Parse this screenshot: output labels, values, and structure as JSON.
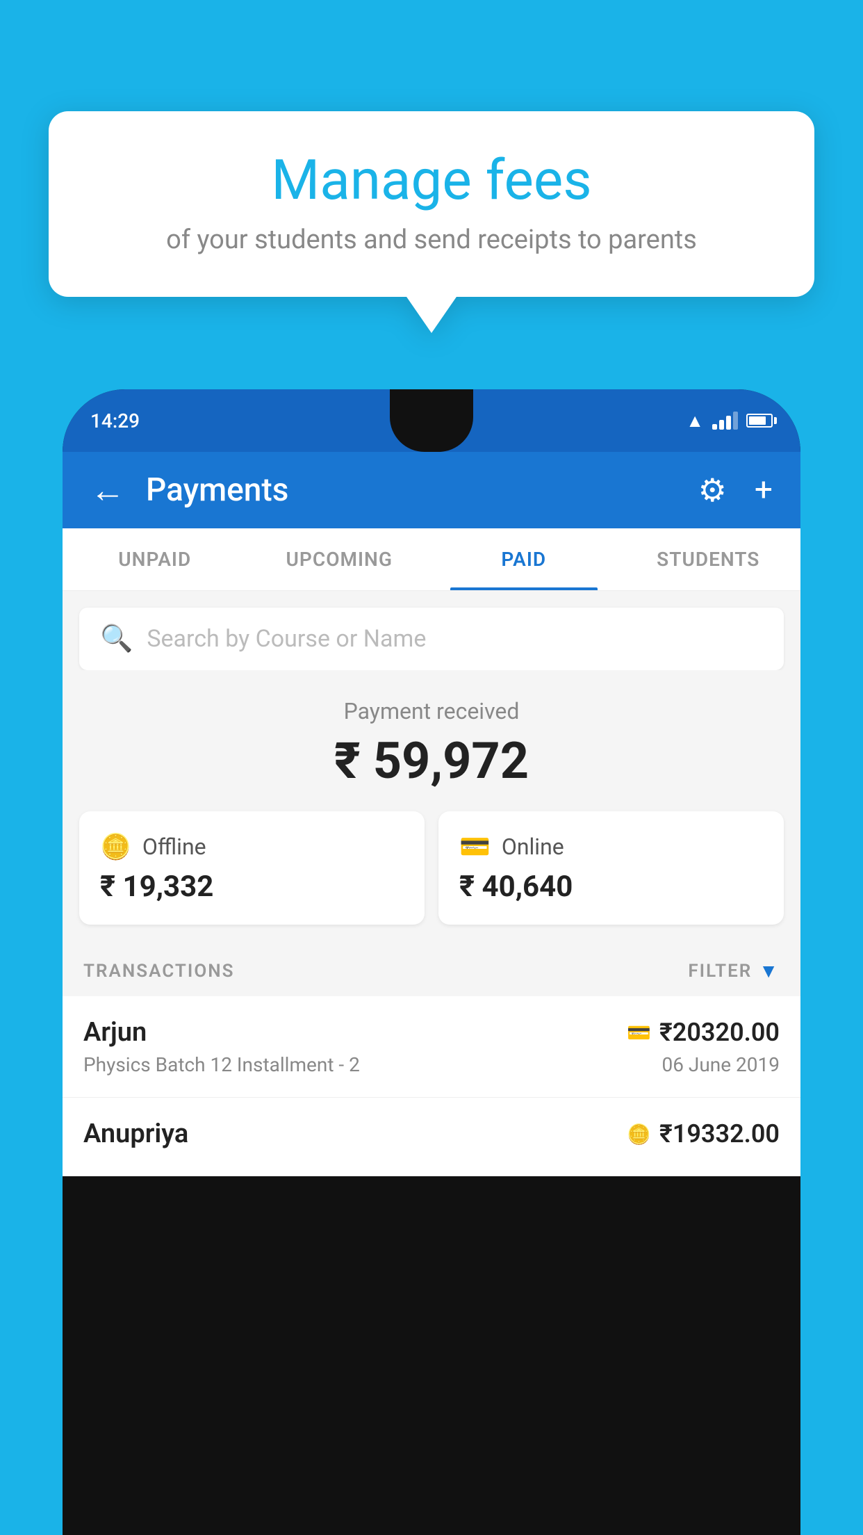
{
  "background_color": "#1ab3e8",
  "speech_bubble": {
    "title": "Manage fees",
    "subtitle": "of your students and send receipts to parents"
  },
  "phone": {
    "status_bar": {
      "time": "14:29"
    },
    "app_header": {
      "title": "Payments",
      "back_label": "←",
      "gear_label": "⚙",
      "plus_label": "+"
    },
    "tabs": [
      {
        "label": "UNPAID",
        "active": false
      },
      {
        "label": "UPCOMING",
        "active": false
      },
      {
        "label": "PAID",
        "active": true
      },
      {
        "label": "STUDENTS",
        "active": false
      }
    ],
    "search": {
      "placeholder": "Search by Course or Name"
    },
    "payment_summary": {
      "label": "Payment received",
      "amount": "₹ 59,972",
      "offline": {
        "type": "Offline",
        "amount": "₹ 19,332"
      },
      "online": {
        "type": "Online",
        "amount": "₹ 40,640"
      }
    },
    "transactions": {
      "section_label": "TRANSACTIONS",
      "filter_label": "FILTER",
      "items": [
        {
          "name": "Arjun",
          "course": "Physics Batch 12 Installment - 2",
          "amount": "₹20320.00",
          "date": "06 June 2019",
          "payment_type": "online"
        },
        {
          "name": "Anupriya",
          "course": "",
          "amount": "₹19332.00",
          "date": "",
          "payment_type": "offline"
        }
      ]
    }
  }
}
